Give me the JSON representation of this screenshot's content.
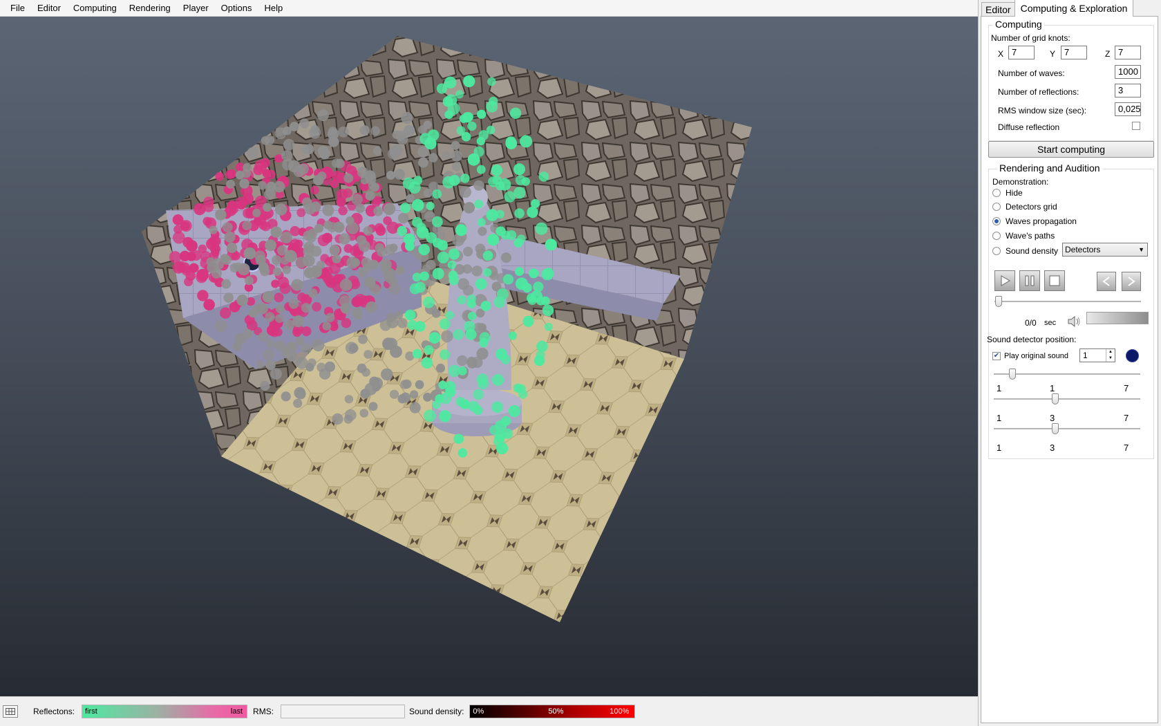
{
  "menu": [
    "File",
    "Editor",
    "Computing",
    "Rendering",
    "Player",
    "Options",
    "Help"
  ],
  "tabs": {
    "editor": "Editor",
    "computing": "Computing & Exploration"
  },
  "computing": {
    "title": "Computing",
    "grid_knots_label": "Number of grid knots:",
    "x_label": "X",
    "x_value": "7",
    "y_label": "Y",
    "y_value": "7",
    "z_label": "Z",
    "z_value": "7",
    "waves_label": "Number of waves:",
    "waves_value": "1000",
    "reflections_label": "Number of reflections:",
    "reflections_value": "3",
    "rms_label": "RMS window size (sec):",
    "rms_value": "0,025",
    "diffuse_label": "Diffuse reflection",
    "diffuse_checked": false
  },
  "start_button": "Start computing",
  "rendering": {
    "title": "Rendering and Audition",
    "demonstration_label": "Demonstration:",
    "options": [
      "Hide",
      "Detectors grid",
      "Waves propagation",
      "Wave's paths",
      "Sound density"
    ],
    "selected": "Waves propagation",
    "density_select": "Detectors"
  },
  "player": {
    "time": "0/0",
    "time_unit": "sec",
    "progress": 0
  },
  "detector": {
    "label": "Sound detector position:",
    "play_original_label": "Play original sound",
    "play_original_checked": true,
    "spinner_value": "1",
    "color": "#0a1a66",
    "sliders": [
      {
        "min": "1",
        "value": "1",
        "max": "7"
      },
      {
        "min": "1",
        "value": "3",
        "max": "7"
      },
      {
        "min": "1",
        "value": "3",
        "max": "7"
      }
    ]
  },
  "status": {
    "reflections_label": "Reflectons:",
    "reflections_first": "first",
    "reflections_last": "last",
    "rms_label": "RMS:",
    "density_label": "Sound density:",
    "density_0": "0%",
    "density_50": "50%",
    "density_100": "100%"
  },
  "colors": {
    "first_reflection": "#4de9a0",
    "middle_reflection": "#8f8f8f",
    "last_reflection": "#d8357f"
  }
}
